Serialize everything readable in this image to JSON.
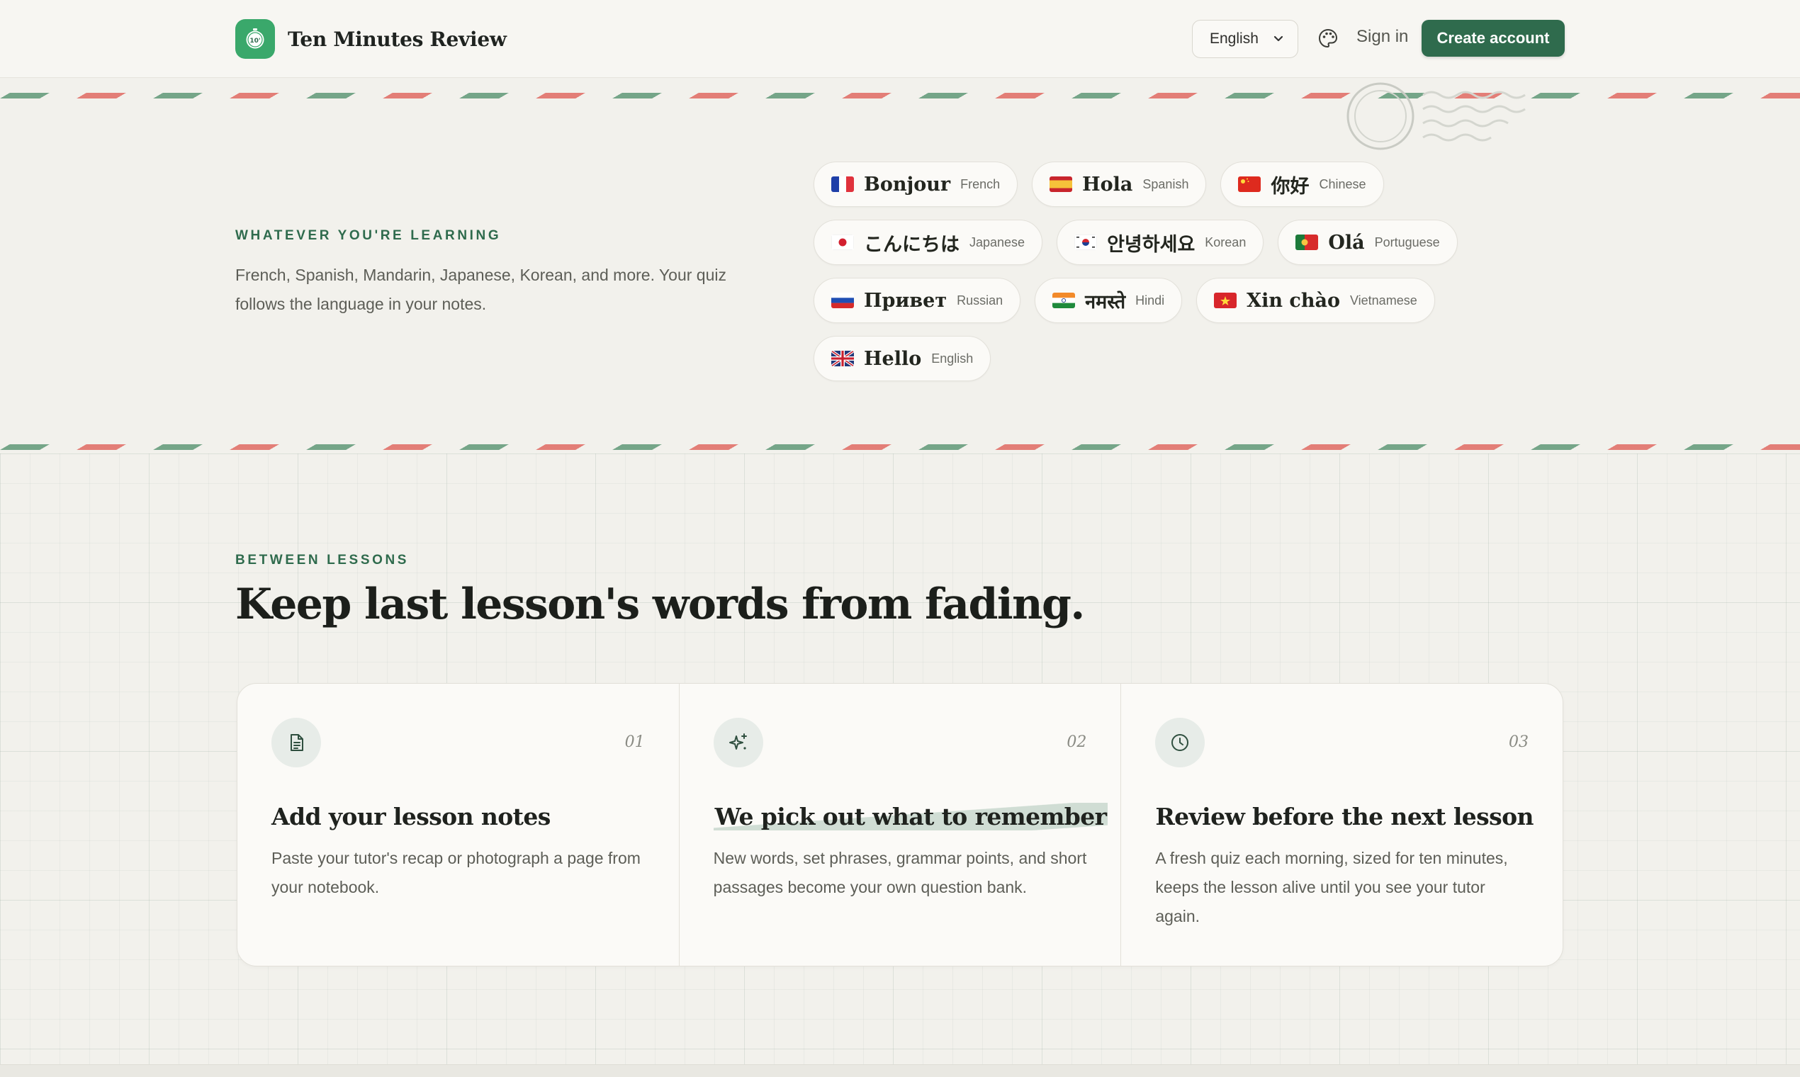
{
  "header": {
    "brand_name": "Ten Minutes Review",
    "logo_text": "10'",
    "language_select": "English",
    "sign_in": "Sign in",
    "create_account": "Create account"
  },
  "languages_section": {
    "eyebrow": "WHATEVER YOU'RE LEARNING",
    "text": "French, Spanish, Mandarin, Japanese, Korean, and more. Your quiz follows the language in your notes.",
    "chips": [
      {
        "greeting": "Bonjour",
        "language": "French",
        "flag": "flag-france"
      },
      {
        "greeting": "Hola",
        "language": "Spanish",
        "flag": "flag-spain"
      },
      {
        "greeting": "你好",
        "language": "Chinese",
        "flag": "flag-china"
      },
      {
        "greeting": "こんにちは",
        "language": "Japanese",
        "flag": "flag-japan"
      },
      {
        "greeting": "안녕하세요",
        "language": "Korean",
        "flag": "flag-korea"
      },
      {
        "greeting": "Olá",
        "language": "Portuguese",
        "flag": "flag-portugal"
      },
      {
        "greeting": "Привет",
        "language": "Russian",
        "flag": "flag-russia"
      },
      {
        "greeting": "नमस्ते",
        "language": "Hindi",
        "flag": "flag-india"
      },
      {
        "greeting": "Xin chào",
        "language": "Vietnamese",
        "flag": "flag-vietnam"
      },
      {
        "greeting": "Hello",
        "language": "English",
        "flag": "flag-uk"
      }
    ]
  },
  "lessons_section": {
    "eyebrow": "BETWEEN LESSONS",
    "title": "Keep last lesson's words from fading.",
    "cards": [
      {
        "number": "01",
        "icon": "document-icon",
        "title": "Add your lesson notes",
        "description": "Paste your tutor's recap or photograph a page from your notebook."
      },
      {
        "number": "02",
        "icon": "sparkles-icon",
        "title": "We pick out what to remember",
        "description": "New words, set phrases, grammar points, and short passages become your own question bank."
      },
      {
        "number": "03",
        "icon": "clock-icon",
        "title": "Review before the next lesson",
        "description": "A fresh quiz each morning, sized for ten minutes, keeps the lesson alive until you see your tutor again."
      }
    ]
  },
  "colors": {
    "brand_green": "#2f6b4d",
    "logo_green": "#3aa86b",
    "stripe_red": "#e06a62",
    "stripe_green": "#5f9877",
    "background": "#f2f1ec"
  }
}
